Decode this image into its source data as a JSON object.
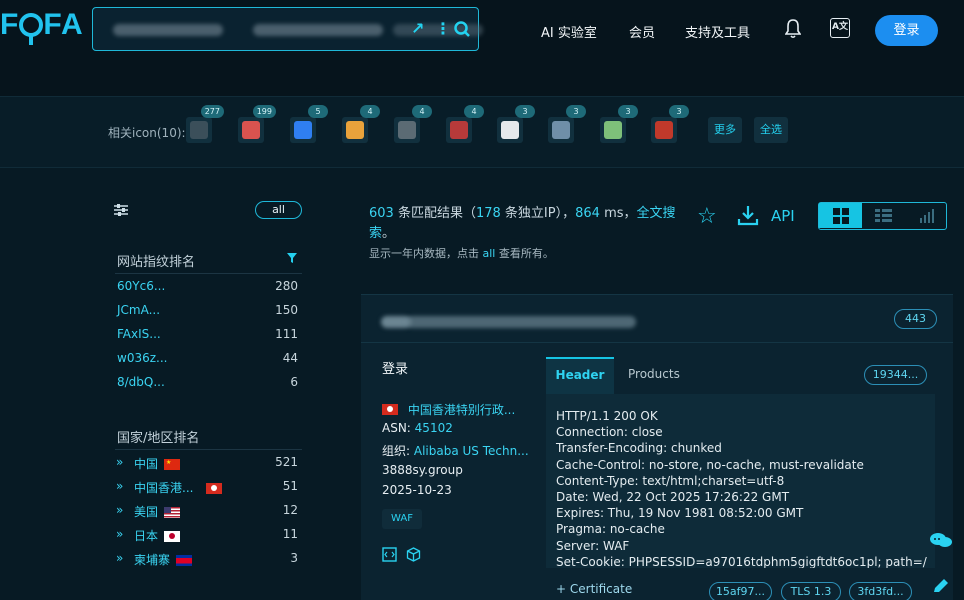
{
  "header": {
    "logo": "F○FA",
    "nav": [
      "AI 实验室",
      "会员",
      "支持及工具"
    ],
    "login": "登录",
    "translate_icon": "A文"
  },
  "icons_bar": {
    "label": "相关icon(10):",
    "items": [
      {
        "count": "277",
        "color": "#3b4f5a"
      },
      {
        "count": "199",
        "color": "#d9534f"
      },
      {
        "count": "5",
        "color": "#2f7ff2"
      },
      {
        "count": "4",
        "color": "#e8a23b"
      },
      {
        "count": "4",
        "color": "#5b6b74"
      },
      {
        "count": "4",
        "color": "#b73a3a"
      },
      {
        "count": "3",
        "color": "#e5e9ec"
      },
      {
        "count": "3",
        "color": "#6f8fa8"
      },
      {
        "count": "3",
        "color": "#7ec07a"
      },
      {
        "count": "3",
        "color": "#c0392b"
      }
    ],
    "more": "更多",
    "select_all": "全选"
  },
  "left": {
    "all_pill": "all",
    "fingerprint_title": "网站指纹排名",
    "fingerprints": [
      {
        "label": "60Yc6...",
        "count": "280"
      },
      {
        "label": "JCmA...",
        "count": "150"
      },
      {
        "label": "FAxIS...",
        "count": "111"
      },
      {
        "label": "w036z...",
        "count": "44"
      },
      {
        "label": "8/dbQ...",
        "count": "6"
      }
    ],
    "country_title": "国家/地区排名",
    "countries": [
      {
        "label": "中国",
        "count": "521",
        "flag": "cn"
      },
      {
        "label": "中国香港...",
        "count": "51",
        "flag": "hk"
      },
      {
        "label": "美国",
        "count": "12",
        "flag": "us"
      },
      {
        "label": "日本",
        "count": "11",
        "flag": "jp"
      },
      {
        "label": "柬埔寨",
        "count": "3",
        "flag": "kh"
      }
    ],
    "arrow": "»"
  },
  "results": {
    "count": "603",
    "t1": " 条匹配结果（",
    "ip_count": "178",
    "t2": " 条独立IP），",
    "ms": "864",
    "t3": " ms，",
    "fulltext": "全文搜索",
    "t4": "。",
    "note_pre": "显示一年内数据，点击 ",
    "note_link": "all",
    "note_post": " 查看所有。",
    "api": "API"
  },
  "card": {
    "badge_443": "443",
    "title": "登录",
    "location": "中国香港特别行政...",
    "asn_label": "ASN: ",
    "asn": "45102",
    "org_label": "组织: ",
    "org": "Alibaba US Techn...",
    "domain": "3888sy.group",
    "date": "2025-10-23",
    "waf": "WAF",
    "tab_header": "Header",
    "tab_products": "Products",
    "hash_pill": "19344...",
    "header_lines": [
      "HTTP/1.1 200 OK",
      "Connection: close",
      "Transfer-Encoding: chunked",
      "Cache-Control: no-store, no-cache, must-revalidate",
      "Content-Type: text/html;charset=utf-8",
      "Date: Wed, 22 Oct 2025 17:26:22 GMT",
      "Expires: Thu, 19 Nov 1981 08:52:00 GMT",
      "Pragma: no-cache",
      "Server: WAF",
      "Set-Cookie: PHPSESSID=a97016tdphm5gigftdt6oc1pl; path=/"
    ],
    "certificate": "+ Certificate",
    "cert_pills": [
      "15af97...",
      "TLS 1.3",
      "3fd3fd..."
    ]
  }
}
